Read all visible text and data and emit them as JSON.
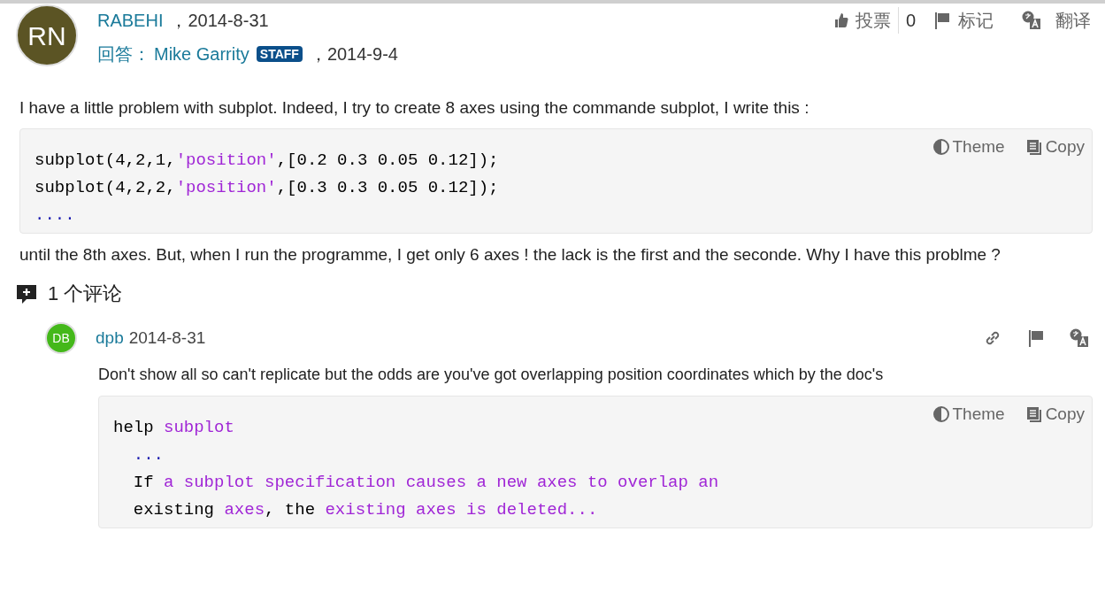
{
  "answer": {
    "avatar_initials": "RN",
    "author": "RABEHI",
    "date": "，2014-8-31",
    "reply_label": "回答：",
    "responder": "Mike Garrity",
    "badge": "STAFF",
    "reply_date": "，2014-9-4"
  },
  "actions": {
    "vote_label": "投票",
    "vote_count": "0",
    "flag_label": "标记",
    "translate_label": "翻译"
  },
  "body": [
    {
      "kind": "paragraph",
      "text": "I have a little problem with subplot. Indeed, I try to create 8 axes using the commande subplot, I write this :"
    },
    {
      "kind": "code",
      "theme_label": "Theme",
      "copy_label": "Copy",
      "lines": [
        [
          {
            "kind": "plain",
            "text": "subplot(4,2,1,"
          },
          {
            "kind": "string",
            "text": "'position'"
          },
          {
            "kind": "plain",
            "text": ",[0.2 0.3 0.05 0.12]);"
          }
        ],
        [
          {
            "kind": "plain",
            "text": "subplot(4,2,2,"
          },
          {
            "kind": "string",
            "text": "'position'"
          },
          {
            "kind": "plain",
            "text": ",[0.3 0.3 0.05 0.12]);"
          }
        ],
        [
          {
            "kind": "dots",
            "text": "...."
          }
        ]
      ]
    },
    {
      "kind": "paragraph",
      "text": "until the 8th axes. But, when I run the programme, I get only 6 axes ! the lack is the first and the seconde. Why I have this problme ?"
    }
  ],
  "comments_header": "1 个评论",
  "comments": [
    {
      "avatar_initials": "DB",
      "author": "dpb",
      "date": "2014-8-31",
      "body": [
        {
          "kind": "paragraph",
          "text": "Don't show all so can't replicate but the odds are you've got overlapping position coordinates which by the doc's"
        },
        {
          "kind": "code",
          "theme_label": "Theme",
          "copy_label": "Copy",
          "lines": [
            [
              {
                "kind": "plain",
                "text": "help "
              },
              {
                "kind": "string",
                "text": "subplot"
              }
            ],
            [
              {
                "kind": "dots",
                "text": "  ..."
              }
            ],
            [
              {
                "kind": "plain",
                "text": "  If "
              },
              {
                "kind": "string",
                "text": "a subplot specification causes a new axes to overlap an"
              }
            ],
            [
              {
                "kind": "plain",
                "text": "  existing "
              },
              {
                "kind": "string",
                "text": "axes"
              },
              {
                "kind": "plain",
                "text": ", the "
              },
              {
                "kind": "string",
                "text": "existing axes is deleted..."
              }
            ]
          ]
        }
      ]
    }
  ]
}
